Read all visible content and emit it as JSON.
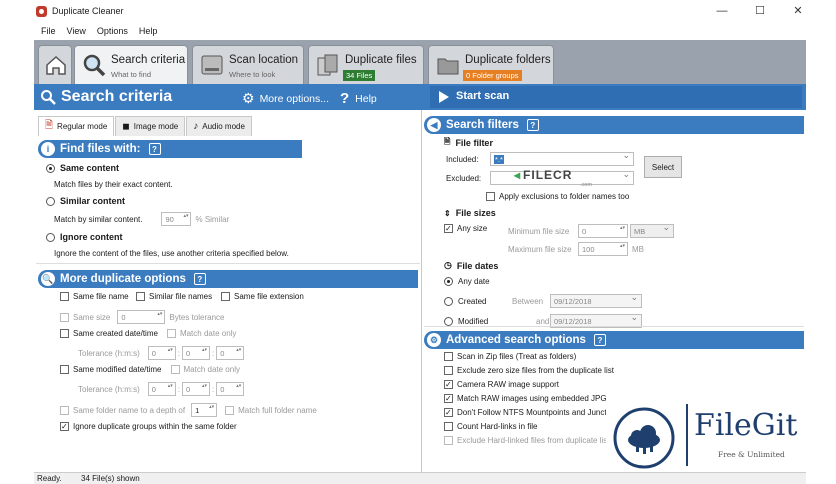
{
  "window": {
    "title": "Duplicate Cleaner",
    "minimize": "—",
    "maximize": "☐",
    "close": "✕"
  },
  "menu": [
    "File",
    "View",
    "Options",
    "Help"
  ],
  "tabs": [
    {
      "label": "Search criteria",
      "sub": "What to find",
      "active": true
    },
    {
      "label": "Scan location",
      "sub": "Where to look"
    },
    {
      "label": "Duplicate files",
      "badge": "34 Files",
      "badge_color": "#2e7d32"
    },
    {
      "label": "Duplicate folders",
      "badge": "0 Folder groups",
      "badge_color": "#e67e22"
    }
  ],
  "header": {
    "title": "Search criteria",
    "more_options": "More options...",
    "help": "Help",
    "start_scan": "Start scan"
  },
  "modes": {
    "regular": "Regular mode",
    "image": "Image mode",
    "audio": "Audio mode"
  },
  "find": {
    "title": "Find files with:",
    "same_content": "Same content",
    "same_content_desc": "Match files by their exact content.",
    "similar_content": "Similar content",
    "similar_desc": "Match by similar content.",
    "similar_value": "90",
    "similar_unit": "% Similar",
    "ignore_content": "Ignore content",
    "ignore_desc": "Ignore the content of the files, use another criteria specified below."
  },
  "more": {
    "title": "More duplicate options",
    "same_file_name": "Same file name",
    "similar_file_names": "Similar file names",
    "same_file_extension": "Same file extension",
    "same_size": "Same size",
    "same_size_value": "0",
    "bytes_tolerance": "Bytes tolerance",
    "same_created": "Same created date/time",
    "match_date_only": "Match date only",
    "tolerance": "Tolerance (h:m:s)",
    "t0": "0",
    "same_modified": "Same modified date/time",
    "same_folder": "Same folder name to a depth of",
    "depth": "1",
    "match_full_folder": "Match full folder name",
    "ignore_groups": "Ignore duplicate groups within the same folder"
  },
  "filters": {
    "title": "Search filters",
    "file_filter": "File filter",
    "included": "Included:",
    "included_value": "*.*",
    "excluded": "Excluded:",
    "select": "Select",
    "apply_exclusions": "Apply exclusions to folder names too",
    "file_sizes": "File sizes",
    "any_size": "Any size",
    "min_size": "Minimum file size",
    "min_value": "0",
    "mb": "MB",
    "max_size": "Maximum file size",
    "max_value": "100",
    "file_dates": "File dates",
    "any_date": "Any date",
    "created": "Created",
    "between": "Between",
    "date1": "09/12/2018",
    "modified": "Modified",
    "and": "and",
    "date2": "09/12/2018"
  },
  "advanced": {
    "title": "Advanced search options",
    "items": [
      {
        "label": "Scan in Zip files (Treat as folders)",
        "checked": false
      },
      {
        "label": "Exclude zero size files from the duplicate list",
        "checked": false
      },
      {
        "label": "Camera RAW image support",
        "checked": true
      },
      {
        "label": "Match RAW images using embedded JPG",
        "checked": true
      },
      {
        "label": "Don't Follow NTFS Mountpoints and Junctions",
        "checked": true
      },
      {
        "label": "Count Hard-links in file",
        "checked": false
      },
      {
        "label": "Exclude Hard-linked files from duplicate list",
        "checked": false,
        "disabled": true
      }
    ]
  },
  "status": {
    "ready": "Ready.",
    "shown": "34 File(s) shown"
  },
  "watermark": {
    "name": "FileGit",
    "tagline": "Free & Unlimited",
    "filecr": "FILECR",
    "filecr_sub": ".com"
  }
}
